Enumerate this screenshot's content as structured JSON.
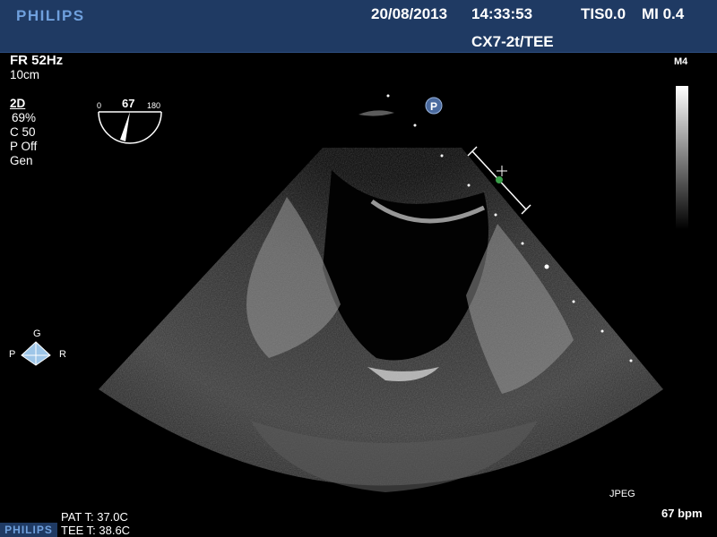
{
  "header": {
    "brand": "PHILIPS",
    "date": "20/08/2013",
    "time": "14:33:53",
    "tis": "TIS0.0",
    "mi": "MI 0.4",
    "probe": "CX7-2t/TEE"
  },
  "left_panel": {
    "frame_rate": "FR 52Hz",
    "depth": "10cm",
    "mode": "2D",
    "gain": "69%",
    "compression": "C 50",
    "persistence": "P Off",
    "preset": "Gen"
  },
  "angle_indicator": {
    "min": "0",
    "value": "67",
    "max": "180"
  },
  "orientation": {
    "top": "G",
    "left": "P",
    "right": "R"
  },
  "map_label": "M4",
  "format_label": "JPEG",
  "heart_rate": "67 bpm",
  "temperatures": {
    "patient": "PAT T: 37.0C",
    "tee": "TEE T: 38.6C"
  },
  "footer_brand": "PHILIPS",
  "focus_marker": "P",
  "colors": {
    "header_bg": "#1f3a63",
    "brand": "#6fa0dd",
    "caliper": "#ffffff",
    "caliper_dot": "#3aa04a"
  }
}
